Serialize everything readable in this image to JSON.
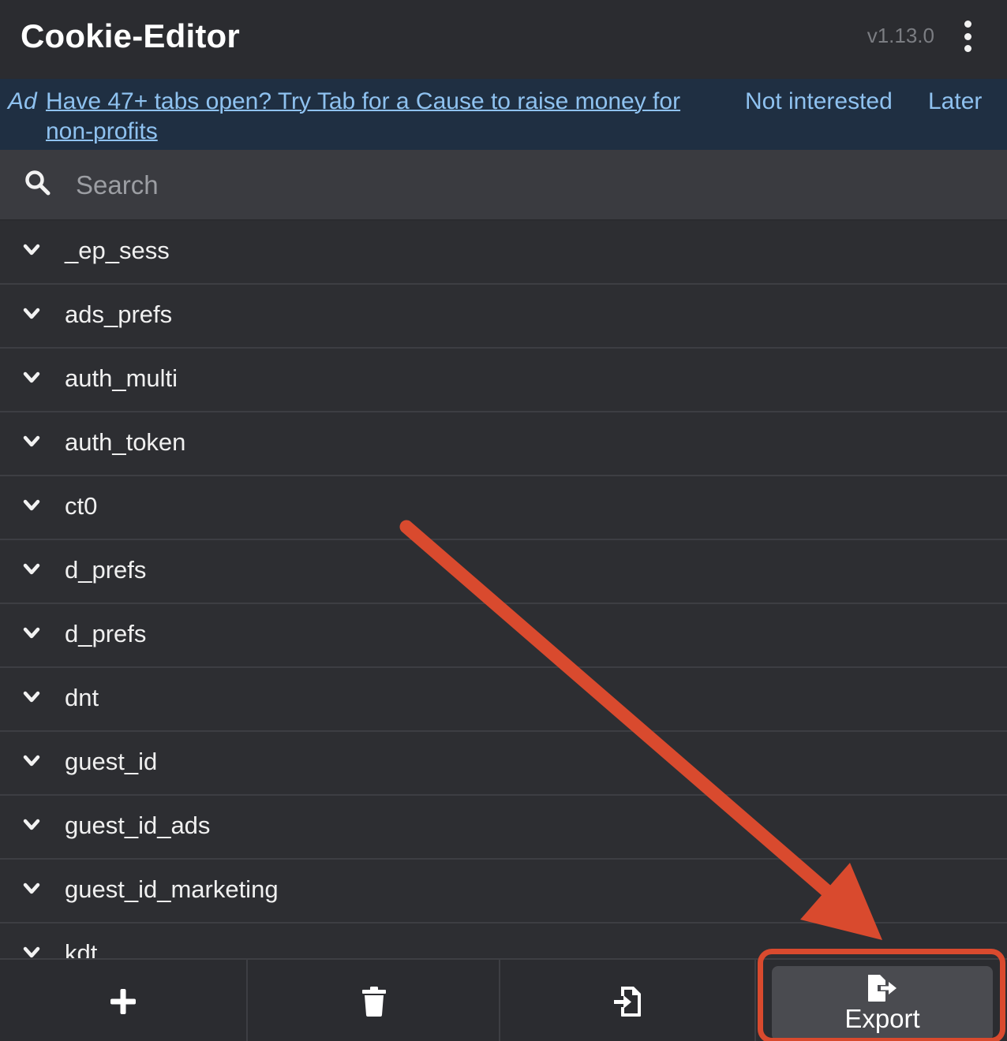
{
  "header": {
    "title": "Cookie-Editor",
    "version": "v1.13.0",
    "menu_icon": "kebab-menu-icon"
  },
  "ad": {
    "tag": "Ad",
    "link_text": "Have 47+ tabs open? Try Tab for a Cause to raise money for non-profits",
    "not_interested": "Not interested",
    "later": "Later"
  },
  "search": {
    "placeholder": "Search",
    "value": "",
    "icon": "search-icon"
  },
  "cookies": [
    {
      "name": "_ep_sess"
    },
    {
      "name": "ads_prefs"
    },
    {
      "name": "auth_multi"
    },
    {
      "name": "auth_token"
    },
    {
      "name": "ct0"
    },
    {
      "name": "d_prefs"
    },
    {
      "name": "d_prefs"
    },
    {
      "name": "dnt"
    },
    {
      "name": "guest_id"
    },
    {
      "name": "guest_id_ads"
    },
    {
      "name": "guest_id_marketing"
    },
    {
      "name": "kdt"
    }
  ],
  "toolbar": {
    "add_icon": "plus-icon",
    "delete_icon": "trash-icon",
    "import_icon": "import-icon",
    "export_icon": "export-icon",
    "export_label": "Export"
  },
  "colors": {
    "background": "#2d2e32",
    "ad_background": "#1f2f42",
    "ad_link": "#8fc2f0",
    "annotation": "#d94a2e"
  }
}
